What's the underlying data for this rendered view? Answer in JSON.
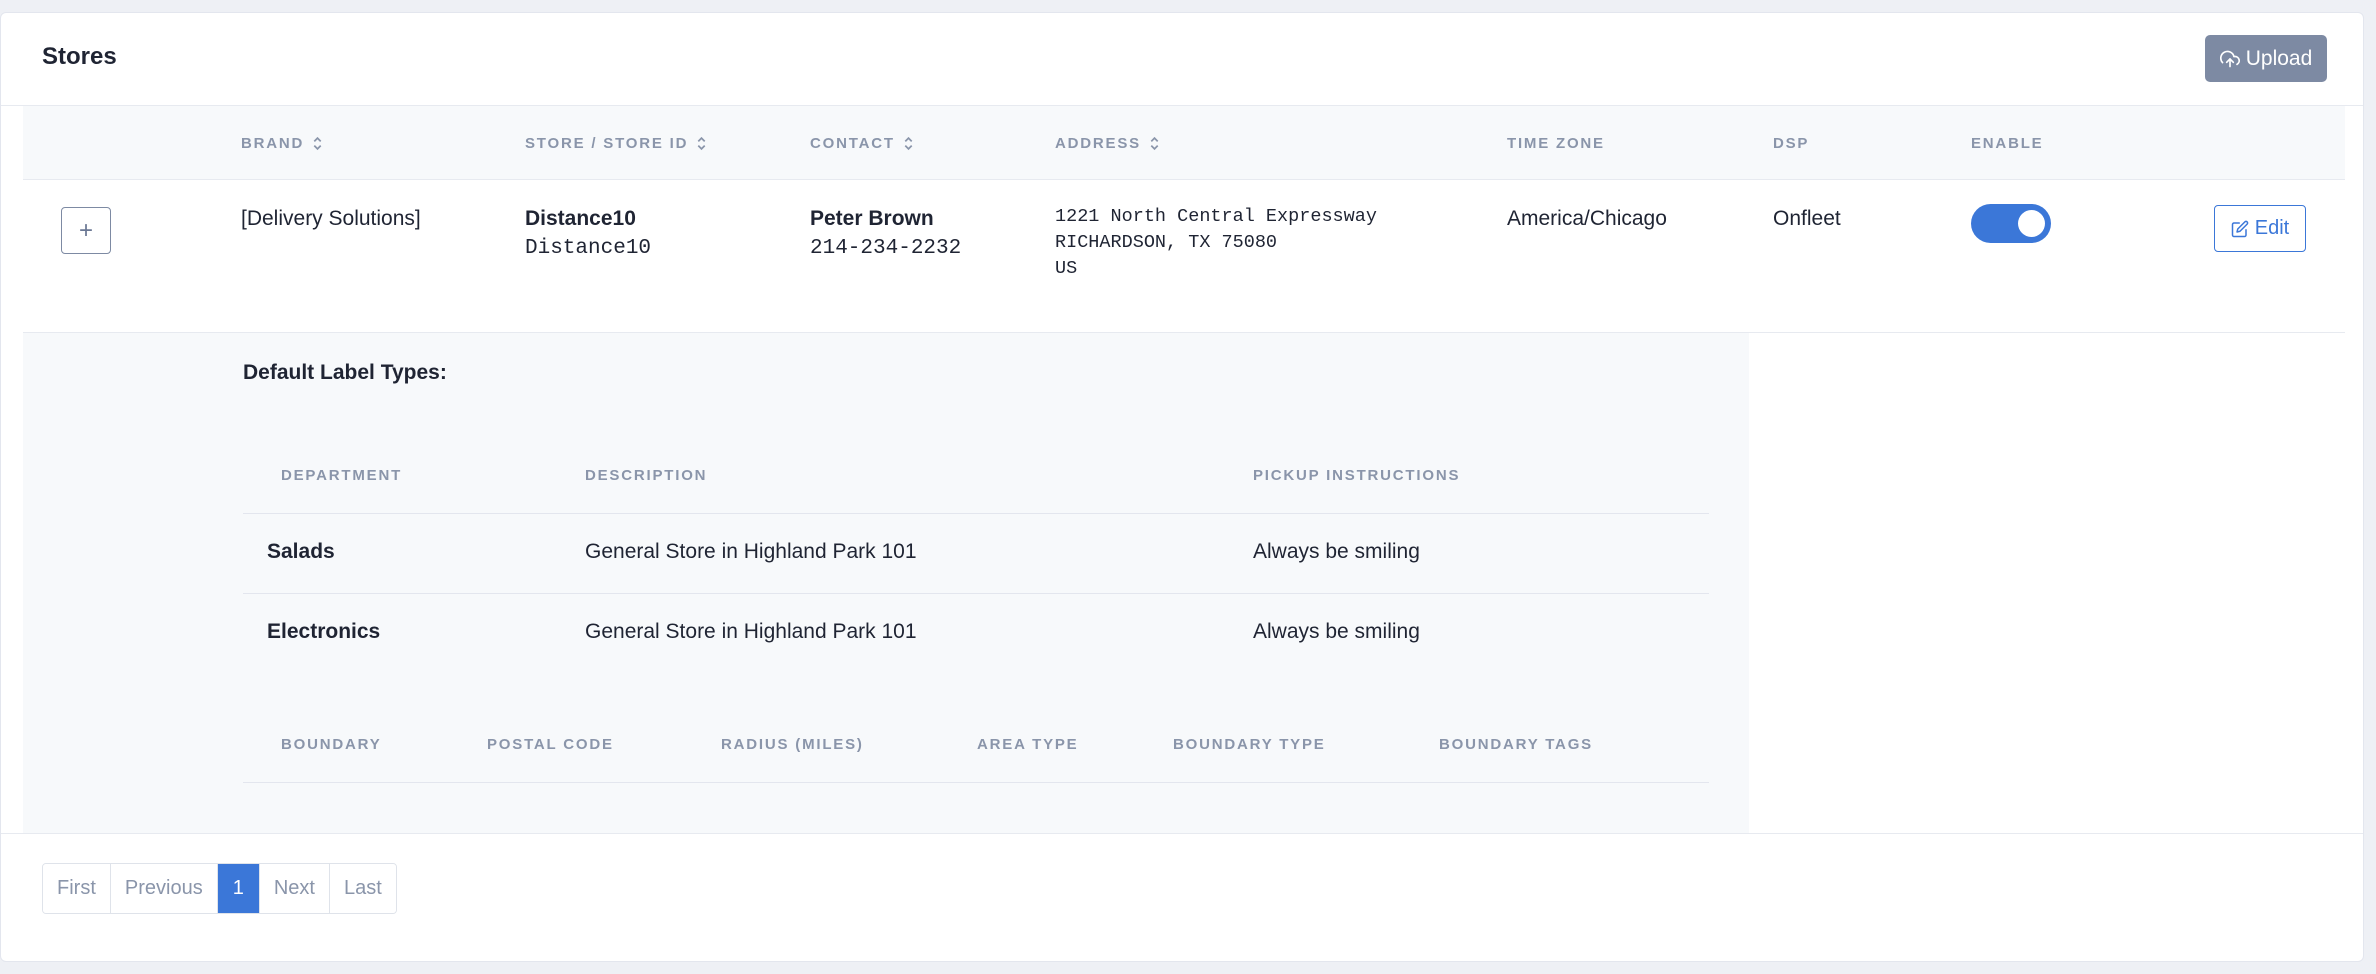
{
  "header": {
    "title": "Stores",
    "upload_label": "Upload"
  },
  "columns": {
    "brand": "BRAND",
    "store": "STORE / STORE ID",
    "contact": "CONTACT",
    "address": "ADDRESS",
    "time_zone": "TIME ZONE",
    "dsp": "DSP",
    "enable": "ENABLE"
  },
  "row": {
    "expand": "+",
    "brand": "[Delivery Solutions]",
    "store_name": "Distance10",
    "store_id": "Distance10",
    "contact_name": "Peter Brown",
    "contact_phone": "214-234-2232",
    "address_line1": "1221 North Central Expressway",
    "address_line2": "RICHARDSON, TX 75080",
    "address_line3": "US",
    "time_zone": "America/Chicago",
    "dsp": "Onfleet",
    "enabled": true,
    "edit_label": "Edit"
  },
  "detail": {
    "title": "Default Label Types:",
    "label_columns": {
      "department": "DEPARTMENT",
      "description": "DESCRIPTION",
      "pickup": "PICKUP INSTRUCTIONS"
    },
    "labels": [
      {
        "department": "Salads",
        "description": "General Store in Highland Park 101",
        "pickup": "Always be smiling"
      },
      {
        "department": "Electronics",
        "description": "General Store in Highland Park 101",
        "pickup": "Always be smiling"
      }
    ],
    "boundary_columns": {
      "boundary": "BOUNDARY",
      "postal_code": "POSTAL CODE",
      "radius": "RADIUS (MILES)",
      "area_type": "AREA TYPE",
      "boundary_type": "BOUNDARY TYPE",
      "boundary_tags": "BOUNDARY TAGS"
    }
  },
  "pagination": {
    "first": "First",
    "previous": "Previous",
    "current": "1",
    "next": "Next",
    "last": "Last"
  },
  "colors": {
    "accent": "#3b77d8",
    "upload_button": "#7d8aa3",
    "muted_text": "#8a95aa"
  }
}
